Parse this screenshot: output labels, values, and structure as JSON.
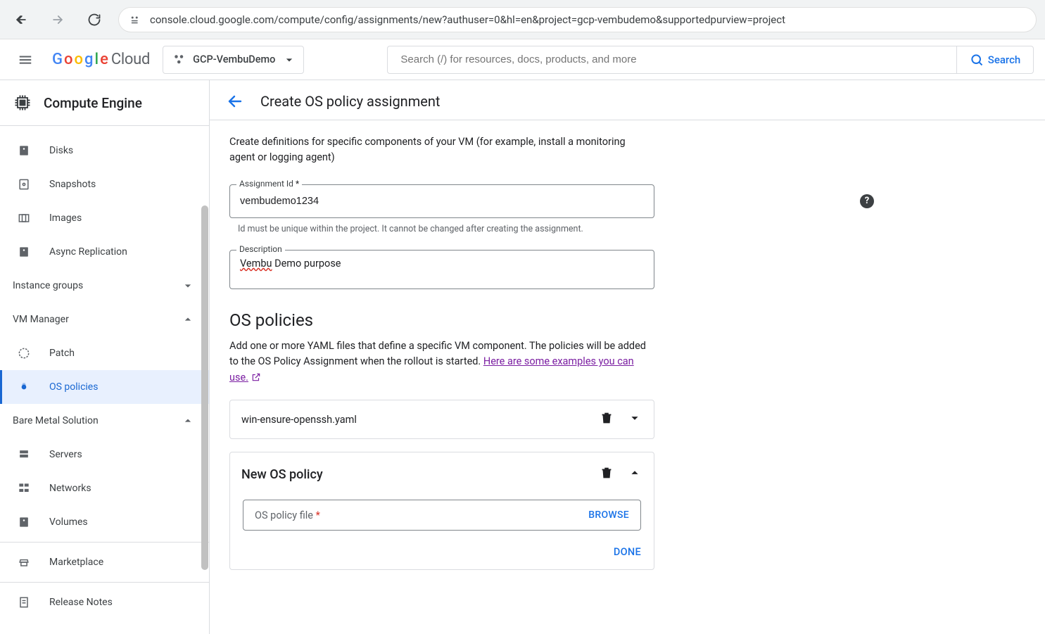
{
  "browser": {
    "url": "console.cloud.google.com/compute/config/assignments/new?authuser=0&hl=en&project=gcp-vembudemo&supportedpurview=project"
  },
  "header": {
    "logo_cloud": "Cloud",
    "project_name": "GCP-VembuDemo",
    "search_placeholder": "Search (/) for resources, docs, products, and more",
    "search_button": "Search"
  },
  "sidebar": {
    "service_title": "Compute Engine",
    "items_top": [
      {
        "label": "Disks",
        "icon": "disk"
      },
      {
        "label": "Snapshots",
        "icon": "snapshot"
      },
      {
        "label": "Images",
        "icon": "image"
      },
      {
        "label": "Async Replication",
        "icon": "disk"
      }
    ],
    "group_instance": {
      "label": "Instance groups",
      "expanded": false
    },
    "group_vm_manager": {
      "label": "VM Manager",
      "expanded": true,
      "children": [
        {
          "label": "Patch",
          "icon": "patch",
          "active": false
        },
        {
          "label": "OS policies",
          "icon": "policy",
          "active": true
        }
      ]
    },
    "group_baremetal": {
      "label": "Bare Metal Solution",
      "expanded": true,
      "children": [
        {
          "label": "Servers",
          "icon": "server"
        },
        {
          "label": "Networks",
          "icon": "network"
        },
        {
          "label": "Volumes",
          "icon": "disk"
        }
      ]
    },
    "bottom": [
      {
        "label": "Marketplace",
        "icon": "marketplace"
      },
      {
        "label": "Release Notes",
        "icon": "releasenotes"
      }
    ]
  },
  "page": {
    "title": "Create OS policy assignment",
    "intro": "Create definitions for specific components of your VM (for example, install a monitoring agent or logging agent)",
    "assignment_id": {
      "label": "Assignment Id",
      "required": "*",
      "value": "vembudemo1234",
      "hint": "Id must be unique within the project. It cannot be changed after creating the assignment."
    },
    "description": {
      "label": "Description",
      "value_word1": "Vembu",
      "value_rest": " Demo purpose"
    },
    "os_section": {
      "title": "OS policies",
      "help_prefix": "Add one or more YAML files that define a specific VM component. The policies will be added to the OS Policy Assignment when the rollout is started.  ",
      "link_text": "Here are some examples you can use.",
      "existing_policy": "win-ensure-openssh.yaml",
      "new_policy_title": "New OS policy",
      "file_label": "OS policy file",
      "file_required": "*",
      "browse": "BROWSE",
      "done": "DONE"
    }
  }
}
